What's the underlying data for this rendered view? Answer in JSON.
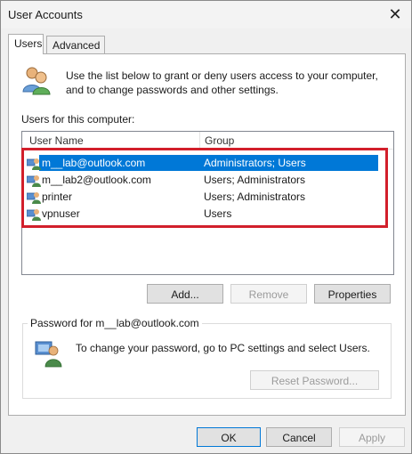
{
  "window": {
    "title": "User Accounts",
    "close_label": "✕"
  },
  "tabs": [
    {
      "label": "Users"
    },
    {
      "label": "Advanced"
    }
  ],
  "intro": {
    "text": "Use the list below to grant or deny users access to your computer, and to change passwords and other settings."
  },
  "users_label": "Users for this computer:",
  "columns": {
    "user_name": "User Name",
    "group": "Group"
  },
  "users": [
    {
      "name": "m__lab@outlook.com",
      "group": "Administrators; Users",
      "selected": true
    },
    {
      "name": "m__lab2@outlook.com",
      "group": "Users; Administrators",
      "selected": false
    },
    {
      "name": "printer",
      "group": "Users; Administrators",
      "selected": false
    },
    {
      "name": "vpnuser",
      "group": "Users",
      "selected": false
    }
  ],
  "buttons": {
    "add": "Add...",
    "remove": "Remove",
    "properties": "Properties",
    "reset_password": "Reset Password...",
    "ok": "OK",
    "cancel": "Cancel",
    "apply": "Apply"
  },
  "password_group": {
    "label": "Password for m__lab@outlook.com",
    "text": "To change your password, go to PC settings and select Users."
  },
  "colors": {
    "selection": "#0078d7",
    "highlight_box": "#d21f2b"
  },
  "icons": {
    "users": "users-icon",
    "user_row": "user-icon",
    "password_user": "password-user-icon"
  }
}
